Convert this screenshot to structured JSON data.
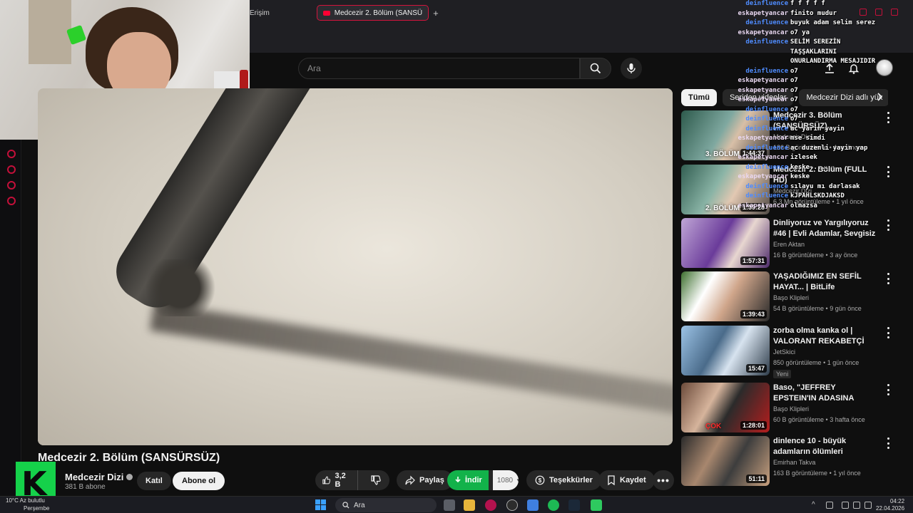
{
  "browser": {
    "tab_partial": "Erişim",
    "tab_active": "Medcezir 2. Bölüm (SANSÜ",
    "new_tab": "+"
  },
  "header": {
    "search_placeholder": "Ara",
    "icons": [
      "search-icon",
      "mic-icon",
      "upload-icon",
      "bell-icon"
    ]
  },
  "video": {
    "title": "Medcezir 2. Bölüm (SANSÜRSÜZ)",
    "channel_name": "Medcezir Dizi",
    "subscribers": "381 B abone",
    "join_label": "Katıl",
    "subscribe_label": "Abone ol",
    "like_count": "3,2 B",
    "share_label": "Paylaş",
    "download_label": "İndir",
    "quality": "1080",
    "thanks_label": "Teşekkürler",
    "save_label": "Kaydet"
  },
  "chips": [
    "Tümü",
    "Seriden videolar",
    "Medcezir Dizi adlı yük"
  ],
  "recommended": [
    {
      "title": "Medcezir 3. Bölüm (SANSÜRSÜZ)",
      "channel": "Medcezir Dizi",
      "views": "186 B görüntüleme",
      "age": "4 ay önce",
      "duration": "1:44:37",
      "caption": "3. BÖLÜM",
      "badge": ""
    },
    {
      "title": "Medcezir 2. Bölüm (FULL HD)",
      "channel": "Medcezir Dizi",
      "views": "6,3 Mn görüntüleme",
      "age": "1 yıl önce",
      "duration": "1:39:28",
      "caption": "2. BÖLÜM",
      "badge": ""
    },
    {
      "title": "Dinliyoruz ve Yargılıyoruz #46 | Evli Adamlar, Sevgisiz Aileler v...",
      "channel": "Eren Aktan",
      "views": "16 B görüntüleme",
      "age": "3 ay önce",
      "duration": "1:57:31",
      "caption": "",
      "badge": ""
    },
    {
      "title": "YAŞADIĞIMIZ EN SEFİL HAYAT... | BitLife",
      "channel": "Başo Klipleri",
      "views": "54 B görüntüleme",
      "age": "9 gün önce",
      "duration": "1:39:43",
      "caption": "",
      "badge": ""
    },
    {
      "title": "zorba olma kanka ol | VALORANT REKABETÇİ",
      "channel": "JetSkici",
      "views": "850 görüntüleme",
      "age": "1 gün önce",
      "duration": "15:47",
      "caption": "",
      "badge": "Yeni"
    },
    {
      "title": "Baso, \"JEFFREY EPSTEIN'IN ADASINA SIZDIM! (Tapınak ve ...",
      "channel": "Başo Klipleri",
      "views": "60 B görüntüleme",
      "age": "3 hafta önce",
      "duration": "1:28:01",
      "caption": "ÇOK",
      "badge": ""
    },
    {
      "title": "dinlence 10 - büyük adamların ölümleri",
      "channel": "Emirhan Takva",
      "views": "163 B görüntüleme",
      "age": "1 yıl önce",
      "duration": "51:11",
      "caption": "",
      "badge": ""
    }
  ],
  "chat": [
    {
      "user": "deinfluence",
      "msg": "f f f f f"
    },
    {
      "user": "eskapetyancar",
      "msg": "finito mudur"
    },
    {
      "user": "deinfluence",
      "msg": "buyuk adam selim serez"
    },
    {
      "user": "eskapetyancar",
      "msg": "o7 ya"
    },
    {
      "user": "deinfluence",
      "msg": "SELİM SEREZİN"
    },
    {
      "user": "",
      "msg": "TAŞŞAKLARINI"
    },
    {
      "user": "",
      "msg": "ONURLANDIRMA MESAJIDIR"
    },
    {
      "user": "deinfluence",
      "msg": "o7"
    },
    {
      "user": "eskapetyancar",
      "msg": "o7"
    },
    {
      "user": "eskapetyancar",
      "msg": "o7"
    },
    {
      "user": "eskapetyancar",
      "msg": "o7"
    },
    {
      "user": "deinfluence",
      "msg": "o7"
    },
    {
      "user": "deinfluence",
      "msg": "o7"
    },
    {
      "user": "deinfluence",
      "msg": "ac yarin yayin"
    },
    {
      "user": "eskapetyancar",
      "msg": "mse simdi"
    },
    {
      "user": "deinfluence",
      "msg": "ac duzenli yayin yap"
    },
    {
      "user": "eskapetyancar",
      "msg": "izlesek"
    },
    {
      "user": "deinfluence",
      "msg": "keske....."
    },
    {
      "user": "eskapetyancar",
      "msg": "keske"
    },
    {
      "user": "deinfluence",
      "msg": "sılayu mı darlasak"
    },
    {
      "user": "deinfluence",
      "msg": "kJPAHLSKDJAKSD"
    },
    {
      "user": "eskapetyancar",
      "msg": "olmazsa"
    }
  ],
  "taskbar": {
    "weather": "10°C Az bulutlu",
    "day": "Perşembe",
    "search": "Ara",
    "time": "04:22",
    "date": "22.04.2026"
  },
  "colors": {
    "accent": "#ff0033",
    "download_green": "#12b24a",
    "chat_user_blue": "#4f8cff",
    "overlay_red": "#c4103a"
  }
}
